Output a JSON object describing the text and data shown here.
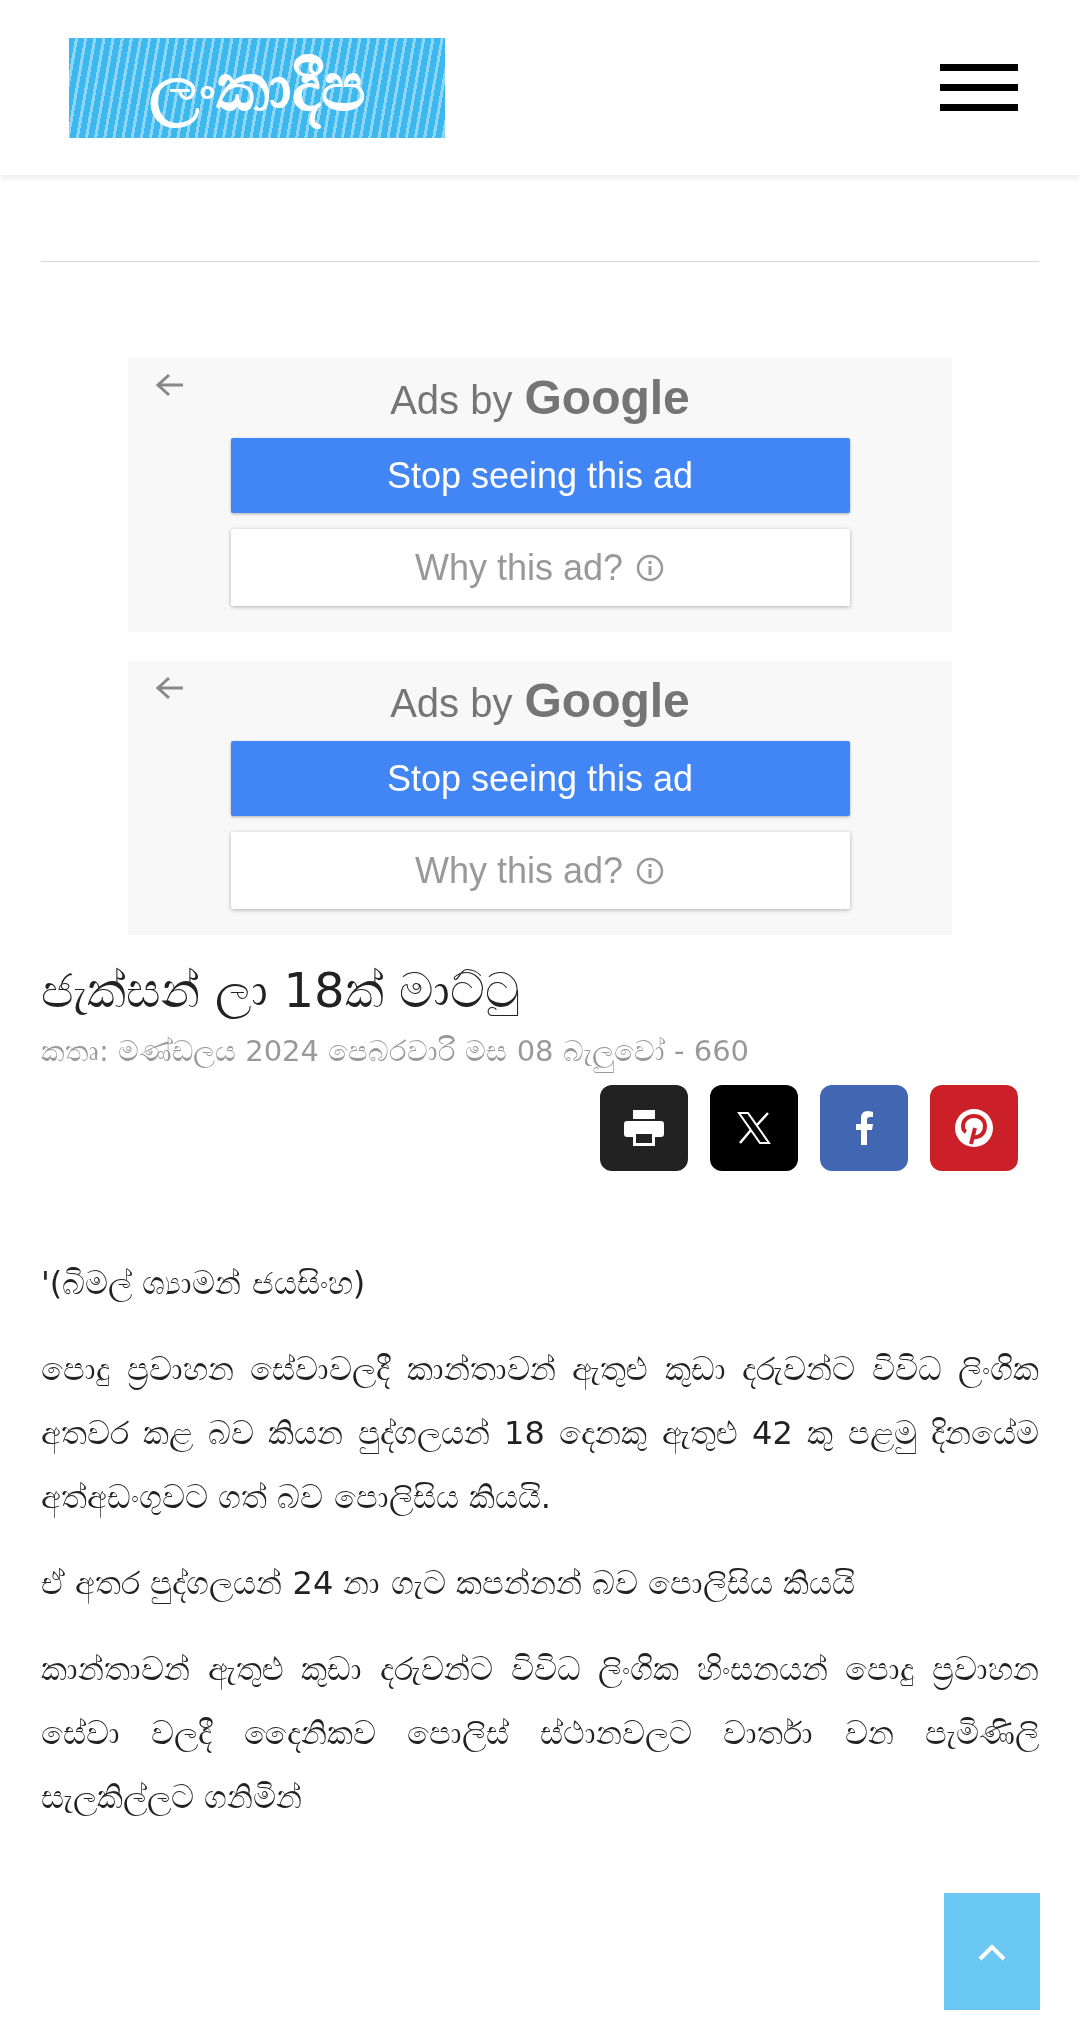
{
  "header": {
    "logo": "ලංකාදීප"
  },
  "ads": [
    {
      "label": "Ads by",
      "brand": "Google",
      "stop_button": "Stop seeing this ad",
      "why_button": "Why this ad?"
    },
    {
      "label": "Ads by",
      "brand": "Google",
      "stop_button": "Stop seeing this ad",
      "why_button": "Why this ad?"
    }
  ],
  "article": {
    "title": "ජැක්සන් ලා 18ක් මාට්ටු",
    "meta": "කතෘ: මණ්ඩලය 2024 පෙබරවාරි මස 08 බැලුවෝ - 660",
    "share": [
      {
        "kind": "print"
      },
      {
        "kind": "x"
      },
      {
        "kind": "facebook"
      },
      {
        "kind": "pinterest"
      }
    ],
    "paragraphs": [
      "'(බිමල් ශ්‍යාමන් ජයසිංහ)",
      "පොදු ප්‍රවාහන සේවාවලදී කාන්තාවන් ඇතුළු කුඩා දරුවන්ට විවිධ ලිංගික අතවර කළ බව කියන පුද්ගලයන් 18 දෙනකු ඇතුළු 42 කු පළමු දිනයේම අත්අඩංගුවට ගත් බව පොලිසිය කියයි.",
      "ඒ අතර පුද්ගලයන් 24 නා ගැට කපන්නන් බව පොලිසිය කියයි",
      "කාන්තාවන් ඇතුළු කුඩා දරුවන්ට විවිධ ලිංගික හිංසනයන් පොදු ප්‍රවාහන සේවා වලදී දෛනිකව පොලිස් ස්ථානවලට වාර්තා වන පැමිණිලි සැලකිල්ලට ගනිමින්"
    ]
  }
}
